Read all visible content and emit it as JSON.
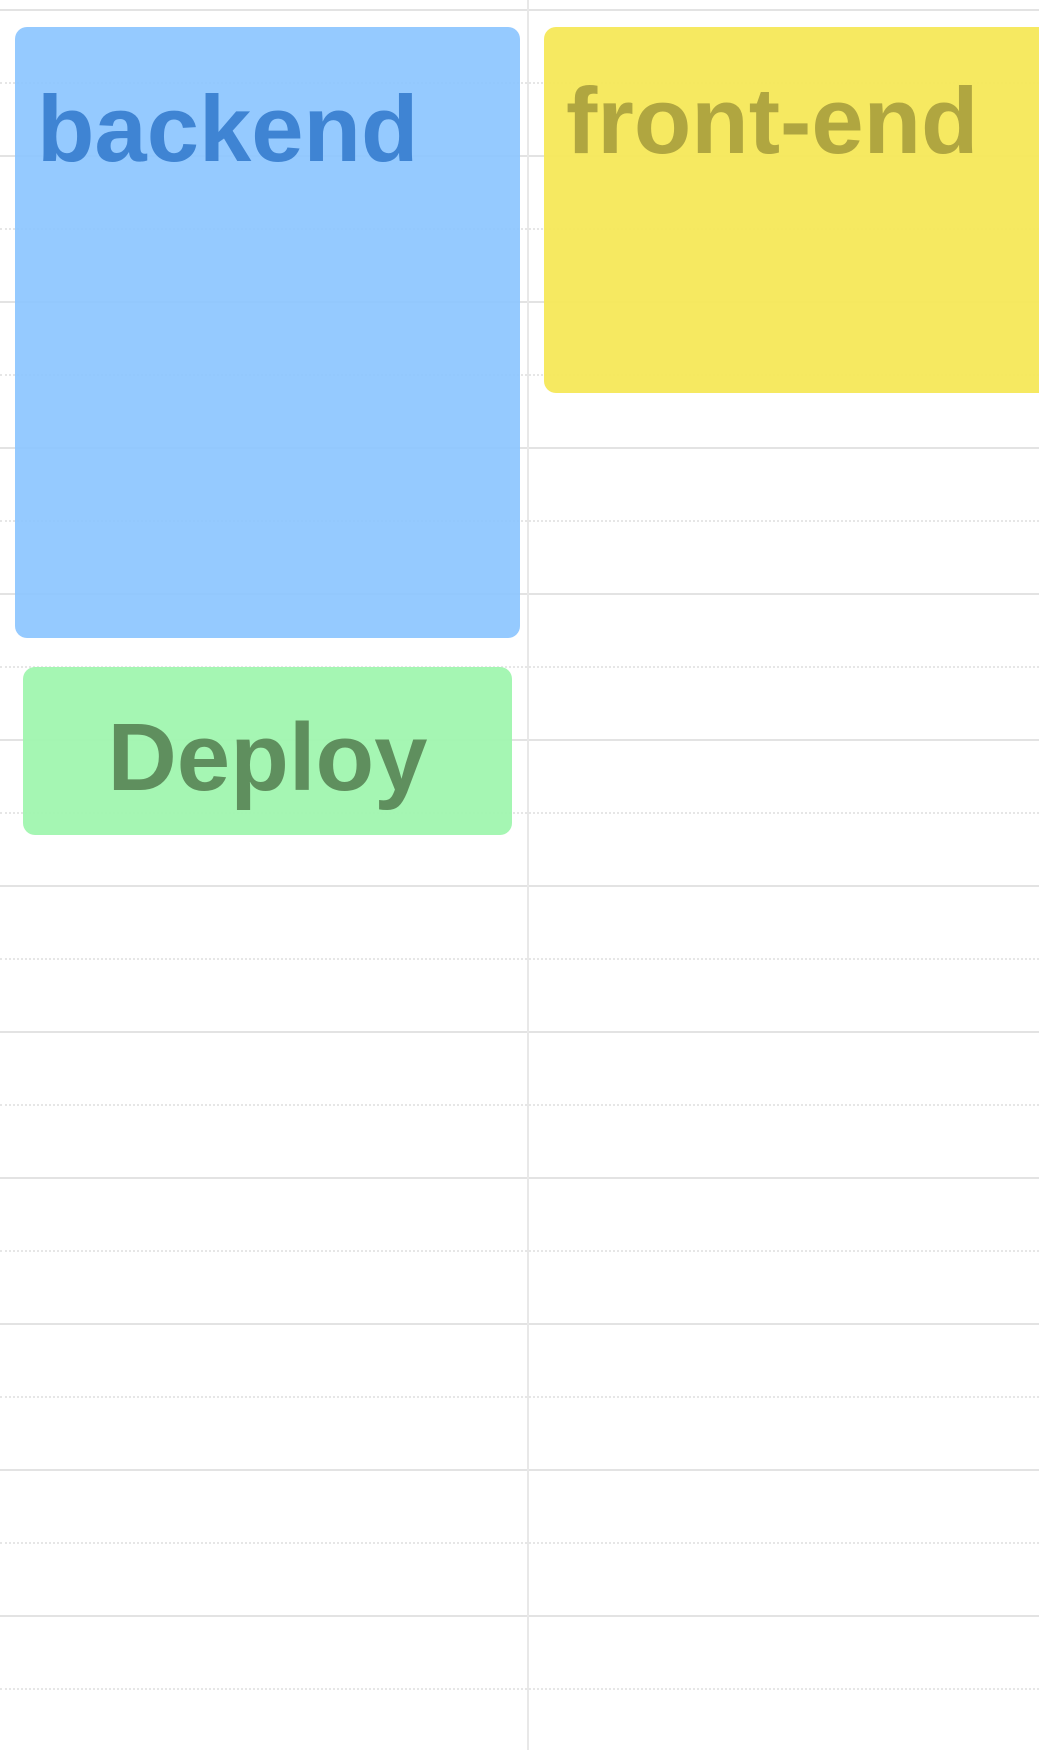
{
  "calendar": {
    "events": [
      {
        "title": "backend",
        "color": "#94CCFF",
        "text_color": "#3F84D3"
      },
      {
        "title": "front-end",
        "color": "#F6E85E",
        "text_color": "#B0A640"
      },
      {
        "title": "Deploy",
        "color": "#A2F6B0",
        "text_color": "#5F8F5E"
      }
    ]
  }
}
